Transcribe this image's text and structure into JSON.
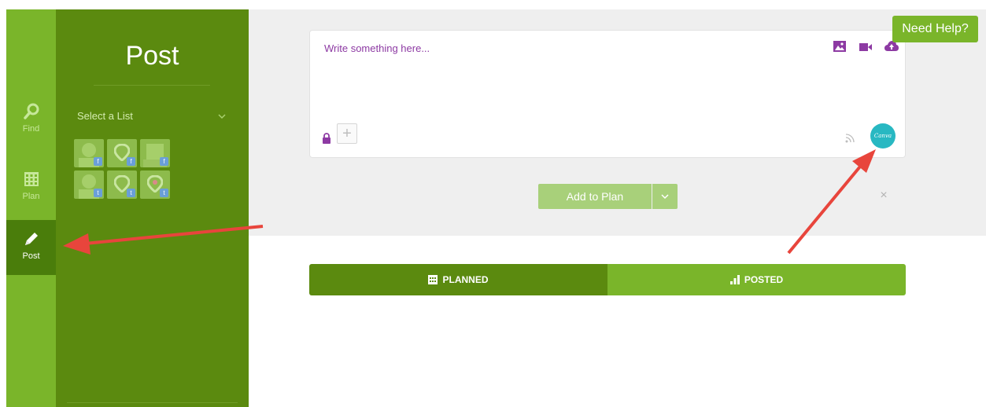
{
  "rail": {
    "items": [
      {
        "label": "Find",
        "icon": "search-icon"
      },
      {
        "label": "Plan",
        "icon": "calendar-icon"
      },
      {
        "label": "Post",
        "icon": "pencil-icon",
        "active": true
      }
    ]
  },
  "panel": {
    "title": "Post",
    "list_select_label": "Select a List",
    "avatars": [
      {
        "network": "f"
      },
      {
        "network": "f"
      },
      {
        "network": "f"
      },
      {
        "network": "t"
      },
      {
        "network": "t"
      },
      {
        "network": "t"
      }
    ]
  },
  "composer": {
    "placeholder": "Write something here...",
    "media_icons": [
      "image-icon",
      "video-icon",
      "upload-cloud-icon"
    ],
    "plus_label": "+",
    "canva_label": "Canva"
  },
  "actions": {
    "add_to_plan_label": "Add to Plan",
    "close_label": "×"
  },
  "help": {
    "label": "Need Help?"
  },
  "tabs": [
    {
      "label": "PLANNED",
      "icon": "calendar-icon"
    },
    {
      "label": "POSTED",
      "icon": "bar-chart-icon"
    }
  ],
  "colors": {
    "rail_green": "#7ab52a",
    "panel_green": "#5b8a0f",
    "active_green": "#4a7d0b",
    "button_light_green": "#a8d07a",
    "placeholder_purple": "#8d3aa3",
    "canva_teal": "#28b8c2",
    "arrow_red": "#e8453c"
  }
}
